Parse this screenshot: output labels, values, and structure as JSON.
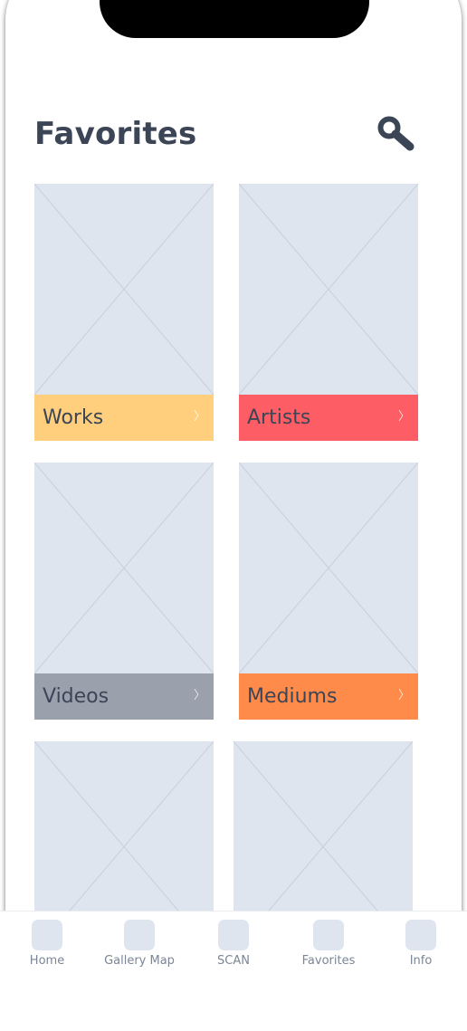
{
  "header": {
    "title": "Favorites",
    "search_icon": "search-icon"
  },
  "tiles": [
    {
      "label": "Works",
      "color": "#ffcf7d",
      "chevron": "〉"
    },
    {
      "label": "Artists",
      "color": "#fd5e66",
      "chevron": "〉"
    },
    {
      "label": "Videos",
      "color": "#9aa1ad",
      "chevron": "〉"
    },
    {
      "label": "Mediums",
      "color": "#ff8b4a",
      "chevron": "〉"
    },
    {
      "label": "",
      "color": "",
      "chevron": ""
    },
    {
      "label": "",
      "color": "",
      "chevron": ""
    }
  ],
  "tab_bar": {
    "items": [
      {
        "label": "Home",
        "icon": "home-icon"
      },
      {
        "label": "Gallery Map",
        "icon": "gallery-map-icon"
      },
      {
        "label": "SCAN",
        "icon": "scan-icon"
      },
      {
        "label": "Favorites",
        "icon": "favorites-icon"
      },
      {
        "label": "Info",
        "icon": "info-icon"
      }
    ]
  },
  "colors": {
    "placeholder": "#dfe5ee",
    "text": "#3c4556",
    "tab_text": "#7b8595"
  }
}
